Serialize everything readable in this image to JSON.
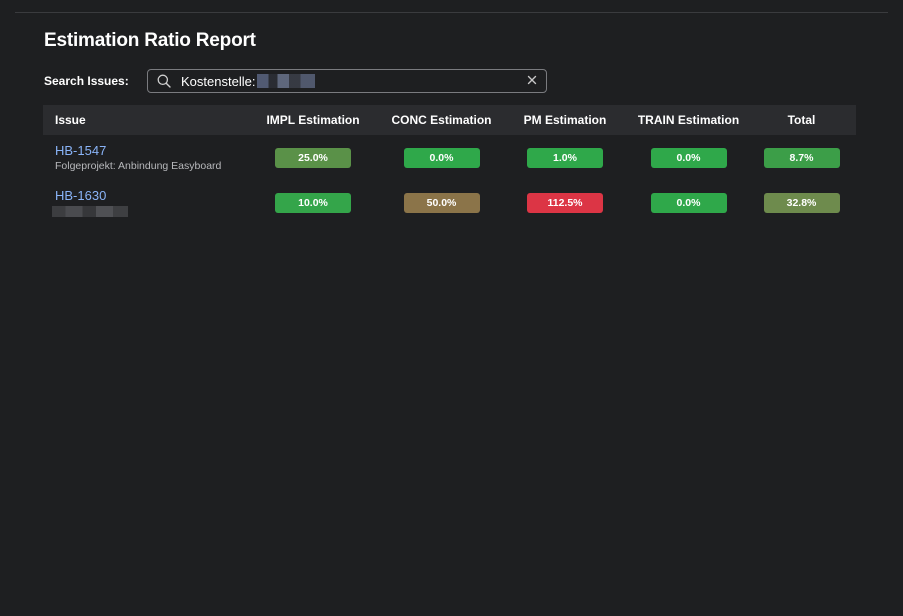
{
  "page": {
    "title": "Estimation Ratio Report"
  },
  "search": {
    "label": "Search Issues:",
    "value": "Kostenstelle:",
    "icon": "search-icon",
    "clear_icon": "close-icon"
  },
  "table": {
    "headers": {
      "issue": "Issue",
      "impl": "IMPL Estimation",
      "conc": "CONC Estimation",
      "pm": "PM Estimation",
      "train": "TRAIN Estimation",
      "total": "Total"
    },
    "rows": [
      {
        "key": "HB-1547",
        "summary": "Folgeprojekt: Anbindung Easyboard",
        "impl": "25.0%",
        "conc": "0.0%",
        "pm": "1.0%",
        "train": "0.0%",
        "total": "8.7%",
        "colors": {
          "impl": "#5a9148",
          "conc": "#2fa84a",
          "pm": "#2fa84a",
          "train": "#2fa84a",
          "total": "#3c9e48"
        }
      },
      {
        "key": "HB-1630",
        "summary": "",
        "impl": "10.0%",
        "conc": "50.0%",
        "pm": "112.5%",
        "train": "0.0%",
        "total": "32.8%",
        "colors": {
          "impl": "#34a54a",
          "conc": "#8b7449",
          "pm": "#dc3545",
          "train": "#2fa84a",
          "total": "#6e8b4d"
        }
      }
    ]
  },
  "colors": {
    "background": "#1e1f21",
    "header_bg": "#2b2c2f",
    "link": "#8ab4f8",
    "good": "#2fa84a",
    "warn": "#8b7449",
    "bad": "#dc3545"
  }
}
